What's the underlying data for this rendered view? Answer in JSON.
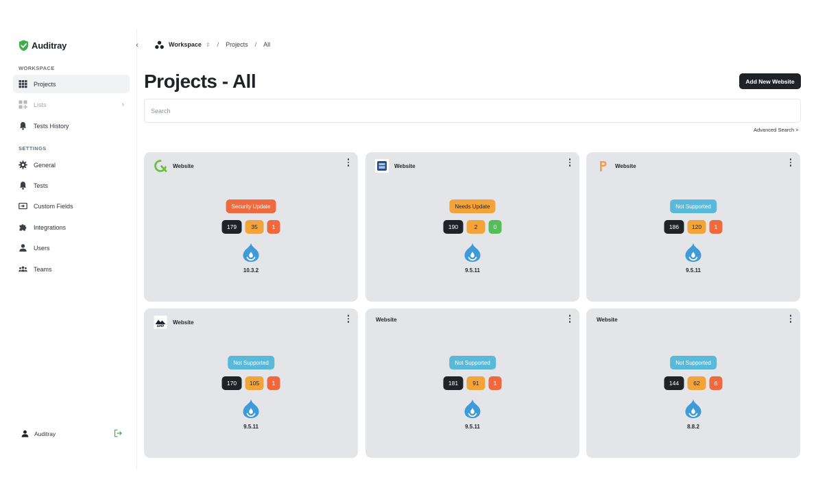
{
  "app": {
    "name": "Auditray"
  },
  "sidebar": {
    "workspace_label": "WORKSPACE",
    "settings_label": "SETTINGS",
    "workspace_items": [
      {
        "label": "Projects",
        "icon": "grid-icon",
        "active": true
      },
      {
        "label": "Lists",
        "icon": "grid-plus-icon",
        "disabled": true
      },
      {
        "label": "Tests History",
        "icon": "bell-icon"
      }
    ],
    "settings_items": [
      {
        "label": "General",
        "icon": "gear-icon"
      },
      {
        "label": "Tests",
        "icon": "bell-icon"
      },
      {
        "label": "Custom Fields",
        "icon": "input-field-icon"
      },
      {
        "label": "Integrations",
        "icon": "puzzle-icon"
      },
      {
        "label": "Users",
        "icon": "user-icon"
      },
      {
        "label": "Teams",
        "icon": "team-icon"
      }
    ],
    "user_name": "Auditray"
  },
  "breadcrumb": {
    "workspace": "Workspace",
    "projects": "Projects",
    "current": "All"
  },
  "page": {
    "title": "Projects - All",
    "add_button": "Add New Website",
    "search_placeholder": "Search",
    "advanced_search": "Advanced Search >"
  },
  "colors": {
    "security_update": "#ee6a3e",
    "needs_update": "#f2a33a",
    "not_supported": "#5ab9d9",
    "count_green": "#56bd5b",
    "count_red": "#ee6a3e",
    "drupal_blue": "#3f9ad8"
  },
  "cards": [
    {
      "name": "Website",
      "logo": "green-q-logo",
      "status": "Security Update",
      "status_color": "#ee6a3e",
      "counts": [
        "179",
        "35",
        "1"
      ],
      "third_color": "#ee6a3e",
      "version": "10.3.2"
    },
    {
      "name": "Website",
      "logo": "blue-square-logo",
      "status": "Needs Update",
      "status_color": "#f2a33a",
      "status_text_dark": true,
      "counts": [
        "190",
        "2",
        "0"
      ],
      "third_color": "#56bd5b",
      "version": "9.5.11"
    },
    {
      "name": "Website",
      "logo": "orange-p-logo",
      "status": "Not Supported",
      "status_color": "#5ab9d9",
      "counts": [
        "186",
        "120",
        "1"
      ],
      "third_color": "#ee6a3e",
      "version": "9.5.11"
    },
    {
      "name": "Website",
      "logo": "amp-logo",
      "status": "Not Supported",
      "status_color": "#5ab9d9",
      "counts": [
        "170",
        "105",
        "1"
      ],
      "third_color": "#ee6a3e",
      "version": "9.5.11"
    },
    {
      "name": "Website",
      "logo": "",
      "status": "Not Supported",
      "status_color": "#5ab9d9",
      "counts": [
        "181",
        "91",
        "1"
      ],
      "third_color": "#ee6a3e",
      "version": "9.5.11"
    },
    {
      "name": "Website",
      "logo": "",
      "status": "Not Supported",
      "status_color": "#5ab9d9",
      "counts": [
        "144",
        "62",
        "6"
      ],
      "third_color": "#ee6a3e",
      "version": "8.8.2"
    }
  ]
}
